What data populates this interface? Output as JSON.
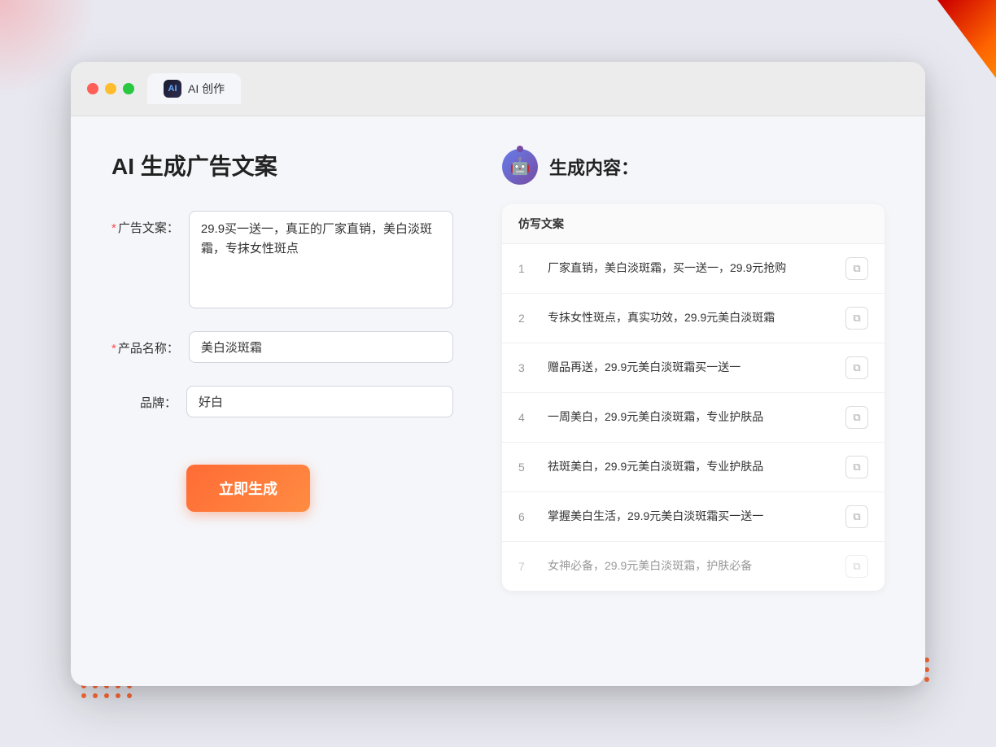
{
  "window": {
    "tab_icon": "AI",
    "tab_label": "AI 创作"
  },
  "left_panel": {
    "title": "AI 生成广告文案",
    "form": {
      "ad_copy_label": "广告文案：",
      "ad_copy_required": "*",
      "ad_copy_value": "29.9买一送一，真正的厂家直销，美白淡斑霜，专抹女性斑点",
      "product_name_label": "产品名称：",
      "product_name_required": "*",
      "product_name_value": "美白淡斑霜",
      "brand_label": "品牌：",
      "brand_value": "好白"
    },
    "generate_button": "立即生成"
  },
  "right_panel": {
    "title": "生成内容：",
    "table_header": "仿写文案",
    "results": [
      {
        "num": "1",
        "text": "厂家直销，美白淡斑霜，买一送一，29.9元抢购"
      },
      {
        "num": "2",
        "text": "专抹女性斑点，真实功效，29.9元美白淡斑霜"
      },
      {
        "num": "3",
        "text": "赠品再送，29.9元美白淡斑霜买一送一"
      },
      {
        "num": "4",
        "text": "一周美白，29.9元美白淡斑霜，专业护肤品"
      },
      {
        "num": "5",
        "text": "祛斑美白，29.9元美白淡斑霜，专业护肤品"
      },
      {
        "num": "6",
        "text": "掌握美白生活，29.9元美白淡斑霜买一送一"
      },
      {
        "num": "7",
        "text": "女神必备，29.9元美白淡斑霜，护肤必备",
        "dim": true
      }
    ]
  }
}
